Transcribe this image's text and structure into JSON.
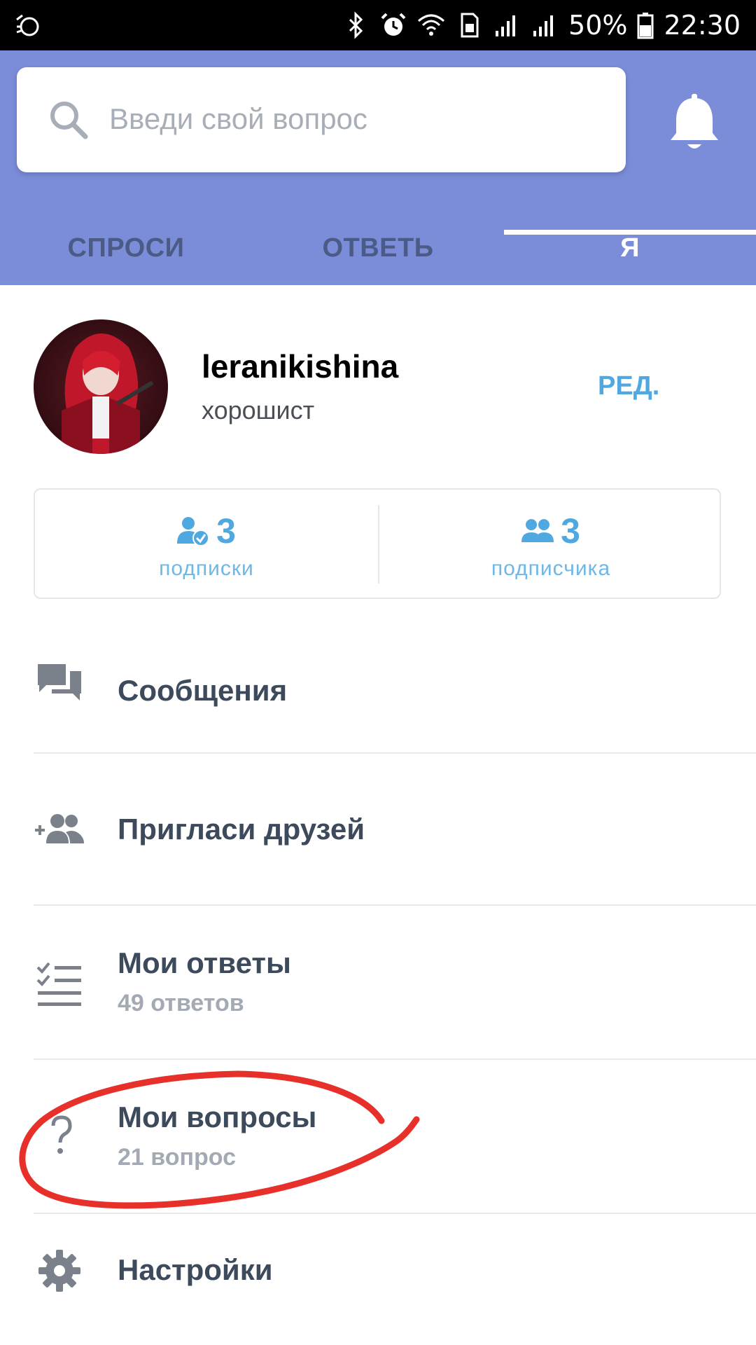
{
  "status_bar": {
    "battery": "50%",
    "time": "22:30",
    "icons": [
      "alarm-left-icon",
      "bluetooth-icon",
      "alarm-clock-icon",
      "wifi-icon",
      "sim-icon",
      "signal-icon",
      "signal-icon",
      "battery-icon"
    ]
  },
  "header": {
    "search_placeholder": "Введи свой вопрос",
    "tabs": [
      {
        "label": "СПРОСИ"
      },
      {
        "label": "ОТВЕТЬ"
      },
      {
        "label": "Я",
        "active": true
      }
    ],
    "accent": "#7b8dd9"
  },
  "profile": {
    "username": "leranikishina",
    "rank": "хорошист",
    "edit_label": "РЕД."
  },
  "stats": {
    "following": {
      "count": "3",
      "label": "подписки"
    },
    "followers": {
      "count": "3",
      "label": "подписчика"
    }
  },
  "menu": {
    "messages": {
      "title": "Сообщения"
    },
    "invite": {
      "title": "Пригласи друзей"
    },
    "answers": {
      "title": "Мои ответы",
      "sub": "49 ответов"
    },
    "questions": {
      "title": "Мои вопросы",
      "sub": "21 вопрос"
    },
    "settings": {
      "title": "Настройки"
    }
  },
  "colors": {
    "link_blue": "#4fa8e0",
    "annotation_red": "#e8302a"
  }
}
